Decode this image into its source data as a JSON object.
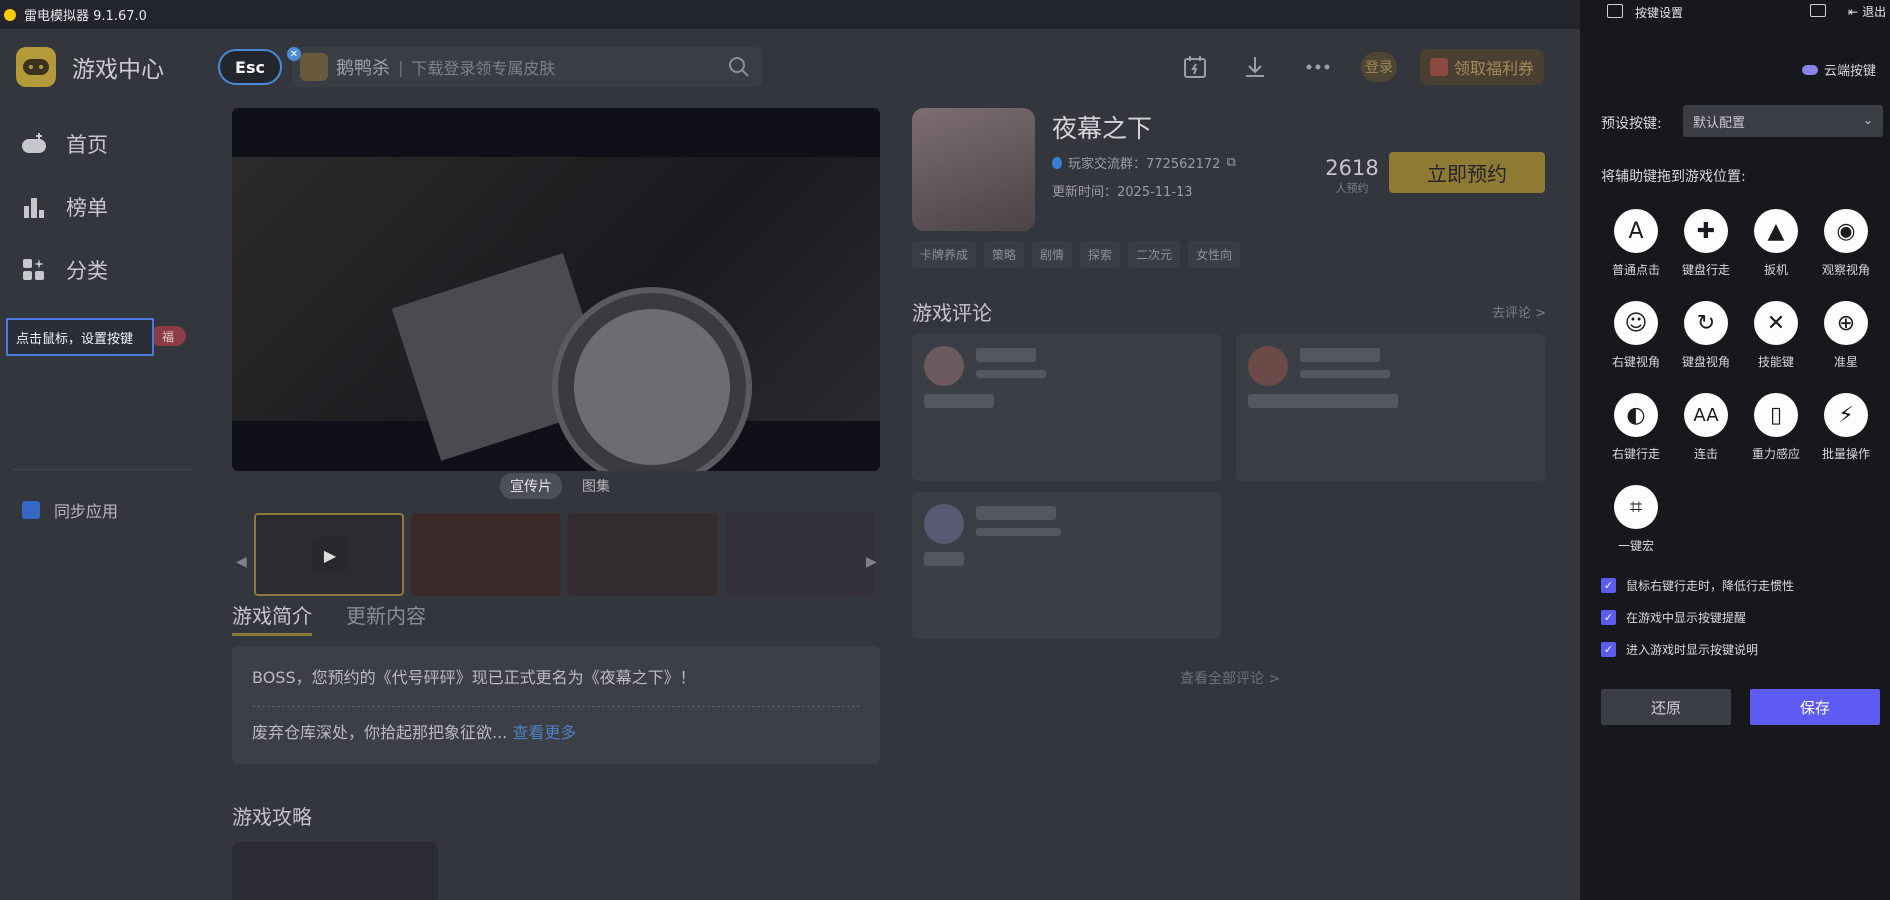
{
  "window": {
    "title": "雷电模拟器 9.1.67.0"
  },
  "sidebar": {
    "brand": "游戏中心",
    "items": [
      {
        "label": "首页",
        "icon": "gamepad-icon"
      },
      {
        "label": "榜单",
        "icon": "ranking-icon"
      },
      {
        "label": "分类",
        "icon": "category-icon"
      }
    ],
    "tooltip": "点击鼠标，设置按键",
    "hot_badge": "福",
    "sync": "同步应用"
  },
  "topbar": {
    "esc": "Esc",
    "search_game": "鹅鸭杀",
    "search_placeholder": "下载登录领专属皮肤",
    "login": "登录",
    "gift": "领取福利券"
  },
  "media": {
    "tabs": [
      "宣传片",
      "图集"
    ]
  },
  "intro": {
    "tabs": [
      "游戏简介",
      "更新内容"
    ],
    "line1": "BOSS，您预约的《代号砰砰》现已正式更名为《夜幕之下》！",
    "line2": "废弃仓库深处，你拾起那把象征欲...",
    "more": "查看更多"
  },
  "guide": {
    "title": "游戏攻略"
  },
  "game": {
    "title": "夜幕之下",
    "qq_group": "玩家交流群：772562172",
    "update_time": "更新时间：2025-11-13",
    "reserve_count": "2618",
    "reserve_count_label": "人预约",
    "reserve_button": "立即预约",
    "tags": [
      "卡牌养成",
      "策略",
      "剧情",
      "探索",
      "二次元",
      "女性向"
    ]
  },
  "reviews": {
    "title": "游戏评论",
    "go": "去评论 >",
    "all": "查看全部评论 >"
  },
  "panel": {
    "title": "按键设置",
    "exit": "退出",
    "cloud": "云端按键",
    "preset_label": "预设按键:",
    "preset_value": "默认配置",
    "drag_label": "将辅助键拖到游戏位置:",
    "keys": [
      {
        "label": "普通点击",
        "glyph": "A",
        "icon": "click-a-icon"
      },
      {
        "label": "键盘行走",
        "glyph": "✚",
        "icon": "dpad-icon"
      },
      {
        "label": "扳机",
        "glyph": "▲",
        "icon": "trigger-icon"
      },
      {
        "label": "观察视角",
        "glyph": "◉",
        "icon": "eye-icon"
      },
      {
        "label": "右键视角",
        "glyph": "☺",
        "icon": "right-view-icon"
      },
      {
        "label": "键盘视角",
        "glyph": "↻",
        "icon": "keyboard-view-icon"
      },
      {
        "label": "技能键",
        "glyph": "✕",
        "icon": "skill-swords-icon"
      },
      {
        "label": "准星",
        "glyph": "⊕",
        "icon": "crosshair-icon"
      },
      {
        "label": "右键行走",
        "glyph": "◐",
        "icon": "mouse-icon"
      },
      {
        "label": "连击",
        "glyph": "AA",
        "icon": "combo-icon"
      },
      {
        "label": "重力感应",
        "glyph": "▯",
        "icon": "gravity-phone-icon"
      },
      {
        "label": "批量操作",
        "glyph": "⚡",
        "icon": "lightning-icon"
      },
      {
        "label": "一键宏",
        "glyph": "⌗",
        "icon": "macro-icon"
      }
    ],
    "checks": [
      "鼠标右键行走时，降低行走惯性",
      "在游戏中显示按键提醒",
      "进入游戏时显示按键说明"
    ],
    "restore": "还原",
    "save": "保存"
  }
}
